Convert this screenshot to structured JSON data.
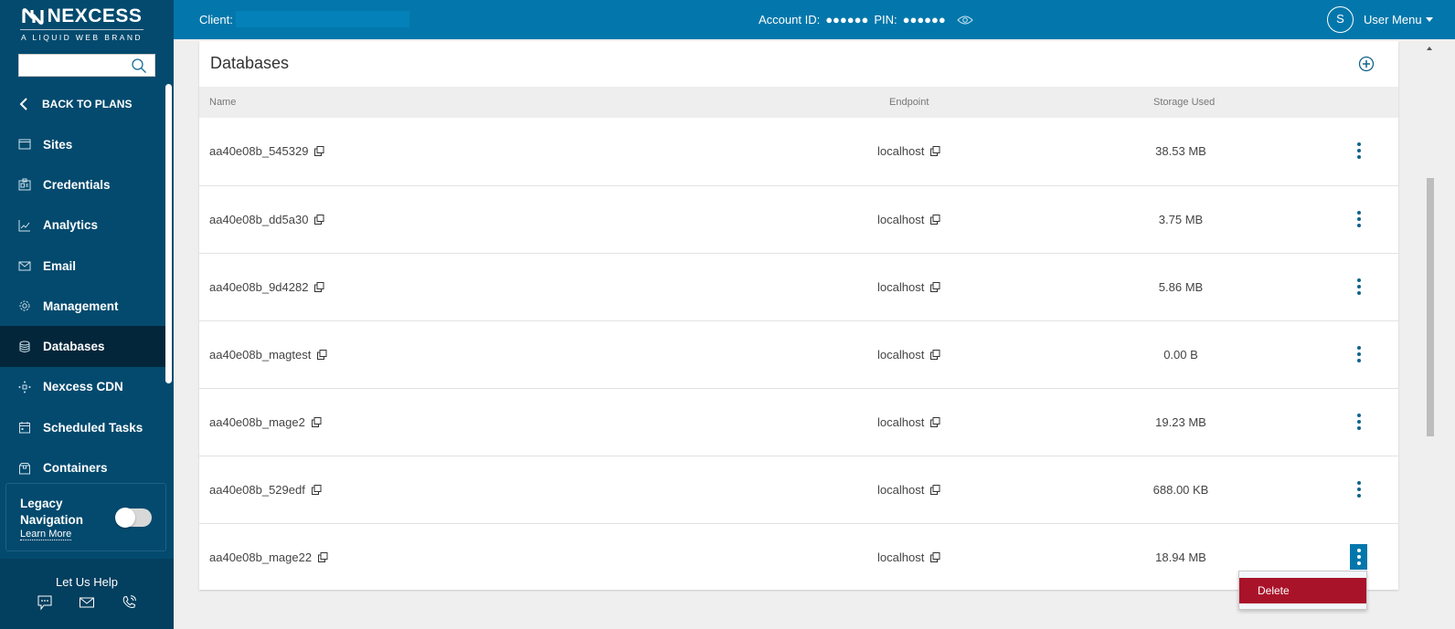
{
  "brand": {
    "name": "NEXCESS",
    "tagline": "A LIQUID WEB BRAND"
  },
  "sidebar": {
    "search": {
      "value": "",
      "placeholder": ""
    },
    "back_label": "BACK TO PLANS",
    "items": [
      {
        "label": "Sites",
        "icon": "browser-window-icon",
        "active": false
      },
      {
        "label": "Credentials",
        "icon": "id-card-icon",
        "active": false
      },
      {
        "label": "Analytics",
        "icon": "line-chart-icon",
        "active": false
      },
      {
        "label": "Email",
        "icon": "envelope-icon",
        "active": false
      },
      {
        "label": "Management",
        "icon": "gear-icon",
        "active": false
      },
      {
        "label": "Databases",
        "icon": "database-icon",
        "active": true
      },
      {
        "label": "Nexcess CDN",
        "icon": "network-nodes-icon",
        "active": false
      },
      {
        "label": "Scheduled Tasks",
        "icon": "calendar-icon",
        "active": false
      },
      {
        "label": "Containers",
        "icon": "box-icon",
        "active": false
      }
    ],
    "legacy": {
      "label": "Legacy Navigation",
      "learn_more": "Learn More",
      "enabled": false
    },
    "help": {
      "title": "Let Us Help",
      "icons": [
        "chat-icon",
        "envelope-icon",
        "phone-icon"
      ]
    }
  },
  "topbar": {
    "client_label": "Client:",
    "account_label": "Account ID:",
    "account_value": "●●●●●●",
    "pin_label": "PIN:",
    "pin_value": "●●●●●●",
    "avatar_initial": "S",
    "user_menu_label": "User Menu"
  },
  "databases": {
    "title": "Databases",
    "columns": {
      "name": "Name",
      "endpoint": "Endpoint",
      "storage": "Storage Used"
    },
    "rows": [
      {
        "name": "aa40e08b_545329",
        "endpoint": "localhost",
        "storage": "38.53 MB"
      },
      {
        "name": "aa40e08b_dd5a30",
        "endpoint": "localhost",
        "storage": "3.75 MB"
      },
      {
        "name": "aa40e08b_9d4282",
        "endpoint": "localhost",
        "storage": "5.86 MB"
      },
      {
        "name": "aa40e08b_magtest",
        "endpoint": "localhost",
        "storage": "0.00 B"
      },
      {
        "name": "aa40e08b_mage2",
        "endpoint": "localhost",
        "storage": "19.23 MB"
      },
      {
        "name": "aa40e08b_529edf",
        "endpoint": "localhost",
        "storage": "688.00 KB"
      },
      {
        "name": "aa40e08b_mage22",
        "endpoint": "localhost",
        "storage": "18.94 MB"
      }
    ],
    "row_menu": {
      "open_row": 6,
      "items": [
        "Delete"
      ]
    }
  },
  "colors": {
    "sidebar": "#034a6e",
    "sidebar_active": "#03263a",
    "topbar": "#0377ab",
    "accent": "#11648a",
    "danger": "#a9132a"
  }
}
